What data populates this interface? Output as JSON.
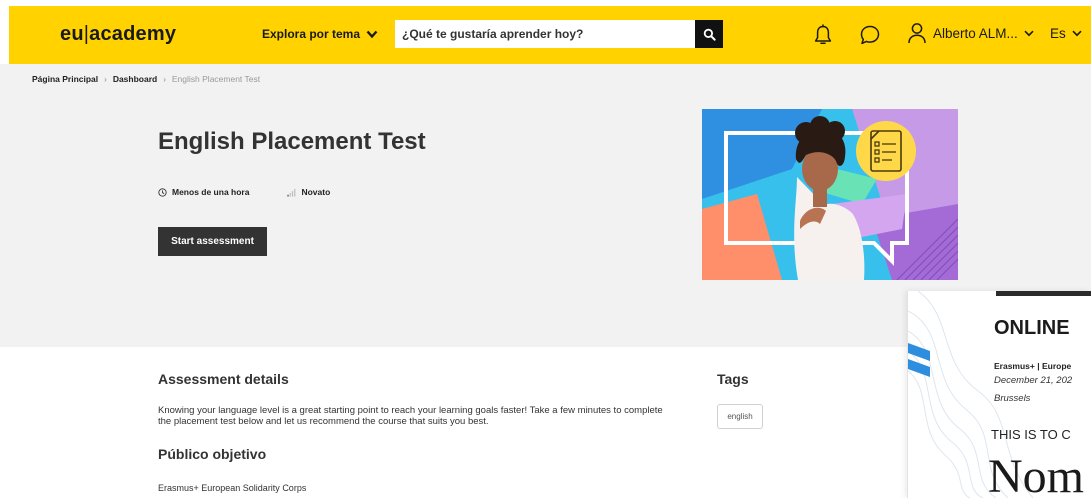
{
  "header": {
    "logo_left": "eu",
    "logo_separator": "|",
    "logo_right": "academy",
    "explore_label": "Explora por tema",
    "search_placeholder": "¿Qué te gustaría aprender hoy?",
    "user_name": "Alberto ALM...",
    "language": "Es",
    "icons": {
      "explore": "chevron-down-icon",
      "search": "search-icon",
      "notifications": "bell-icon",
      "messages": "chat-bubble-icon",
      "user": "user-icon",
      "user_menu": "chevron-down-icon",
      "language_menu": "chevron-down-icon"
    },
    "colors": {
      "background": "#ffd200",
      "search_button": "#111111"
    }
  },
  "breadcrumb": {
    "items": [
      "Página Principal",
      "Dashboard"
    ],
    "separator": "›",
    "current": "English Placement Test"
  },
  "hero": {
    "title": "English Placement Test",
    "duration": "Menos de una hora",
    "level": "Novato",
    "duration_icon": "clock-icon",
    "level_icon": "signal-bars-icon",
    "start_button": "Start assessment",
    "colors": {
      "background": "#f2f2f2",
      "button": "#333333"
    }
  },
  "details": {
    "title": "Assessment details",
    "description": "Knowing your language level is a great starting point to reach your learning goals faster! Take a few minutes to complete the placement test below and let us recommend the course that suits you best.",
    "audience_title": "Público objetivo",
    "audience_text": "Erasmus+ European Solidarity Corps"
  },
  "tags": {
    "title": "Tags",
    "items": [
      "english"
    ]
  },
  "certificate": {
    "title": "ONLINE",
    "org": "Erasmus+ | Europe",
    "date": "December 21, 202",
    "city": "Brussels",
    "certify": "THIS IS TO C",
    "name": "Nom"
  }
}
